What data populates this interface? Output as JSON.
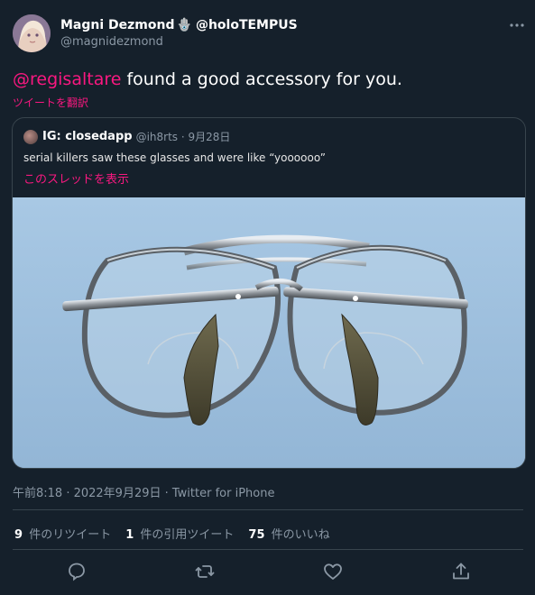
{
  "author": {
    "display_name": "Magni Dezmond",
    "name_emoji": "🪬",
    "name_suffix": "@holoTEMPUS",
    "handle": "@magnidezmond"
  },
  "more_icon": "more-horizontal-icon",
  "tweet": {
    "mention": "@regisaltare",
    "text": " found a good accessory for you.",
    "translate_link": "ツイートを翻訳"
  },
  "quote": {
    "name": "IG: closedapp",
    "meta": "@ih8rts · 9月28日",
    "text": "serial killers saw these glasses and were like “yoooooo”",
    "thread_link": "このスレッドを表示"
  },
  "meta_line": "午前8:18 · 2022年9月29日 · Twitter for iPhone",
  "stats": [
    {
      "num": "9",
      "label": "件のリツイート"
    },
    {
      "num": "1",
      "label": "件の引用ツイート"
    },
    {
      "num": "75",
      "label": "件のいいね"
    }
  ],
  "actions": [
    "reply-icon",
    "retweet-icon",
    "like-icon",
    "share-icon"
  ],
  "colors": {
    "background": "#15202b",
    "accent": "#f91880",
    "muted": "#8b98a5",
    "border": "#38444d"
  }
}
